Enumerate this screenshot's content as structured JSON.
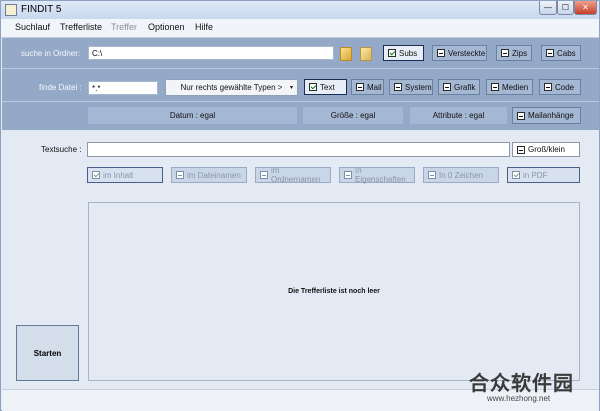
{
  "window": {
    "title": "FINDIT 5",
    "min": "—",
    "max": "☐",
    "close": "✕"
  },
  "menu": [
    "Suchlauf",
    "Trefferliste",
    "Treffer",
    "Optionen",
    "Hilfe"
  ],
  "search_folder": {
    "label": "suche in Ordner:",
    "value": "C:\\"
  },
  "folder_opts": [
    "Subs",
    "Versteckte",
    "Zips",
    "Cabs"
  ],
  "find_file": {
    "label": "finde Datei :",
    "value": "*.*"
  },
  "type_combo": "Nur rechts gewählte Typen >",
  "types": [
    "Text",
    "Mail",
    "System",
    "Grafik",
    "Medien",
    "Code"
  ],
  "filters": {
    "date": "Datum : egal",
    "size": "Größe : egal",
    "attrib": "Attribute : egal",
    "mail_attach": "Mailanhänge"
  },
  "text_search": {
    "label": "Textsuche :",
    "value": "",
    "case": "Groß/klein"
  },
  "search_in": [
    "im Inhalt",
    "im Dateinamen",
    "im Ordnernamen",
    "In Eigenschaften",
    "In 0 Zeichen",
    "in PDF"
  ],
  "results": {
    "empty_msg": "Die Trefferliste ist noch leer"
  },
  "start_label": "Starten",
  "watermark": {
    "name": "合众软件园",
    "url": "www.hezhong.net"
  }
}
